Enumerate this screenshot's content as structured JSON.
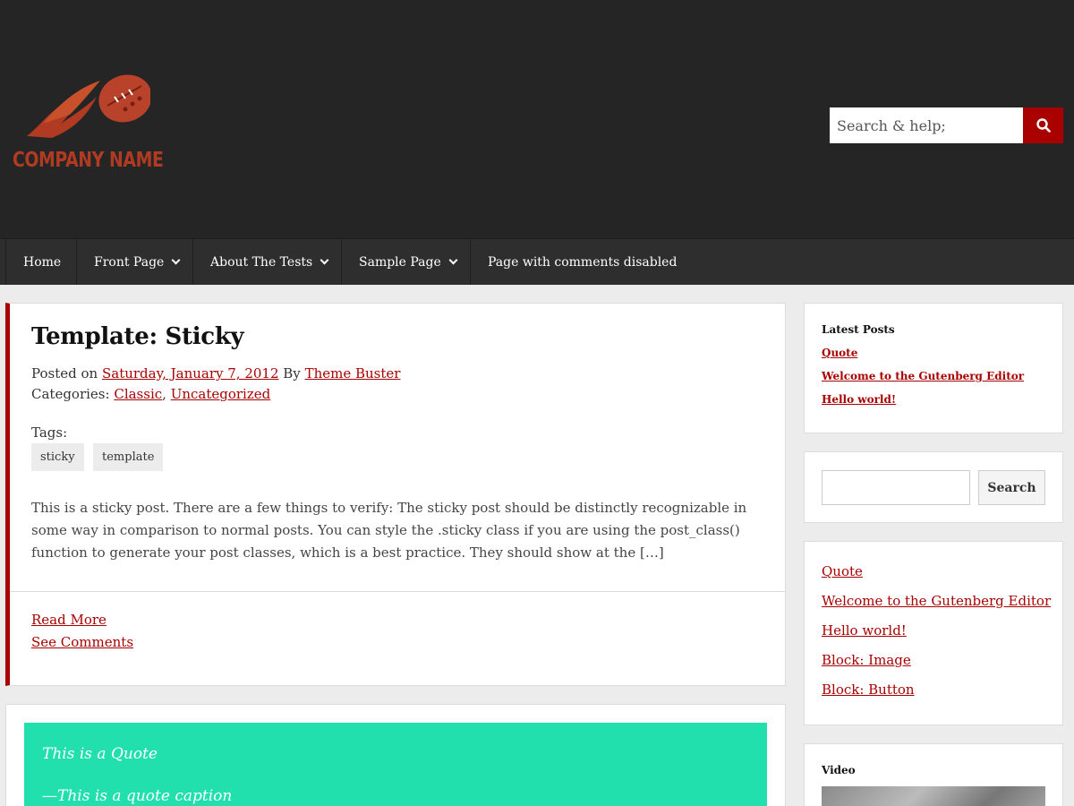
{
  "header": {
    "logo_text": "COMPANY NAME",
    "search_placeholder": "Search & help;",
    "search_icon": "search-icon"
  },
  "nav": {
    "items": [
      {
        "label": "Home"
      },
      {
        "label": "Front Page"
      },
      {
        "label": "About The Tests"
      },
      {
        "label": "Sample Page"
      },
      {
        "label": "Page with comments disabled"
      }
    ]
  },
  "post": {
    "title": "Template: Sticky",
    "posted_on_prefix": "Posted on",
    "date": "Saturday, January 7, 2012",
    "by_label": "By",
    "author": "Theme Buster",
    "categories_label": "Categories:",
    "categories": [
      "Classic",
      "Uncategorized"
    ],
    "tags_label": "Tags:",
    "tags": [
      "sticky",
      "template"
    ],
    "excerpt": "This is a sticky post. There are a few things to verify: The sticky post should be distinctly recognizable in some way in comparison to normal posts. You can style the .sticky class if you are using the post_class() function to generate your post classes, which is a best practice. They should show at the […]",
    "read_more": "Read More",
    "see_comments": "See Comments"
  },
  "quote": {
    "text": "This is a Quote",
    "caption": "—This is a quote caption"
  },
  "sidebar": {
    "latest_posts": {
      "title": "Latest Posts",
      "items": [
        "Quote",
        "Welcome to the Gutenberg Editor",
        "Hello world!"
      ]
    },
    "search": {
      "button_label": "Search"
    },
    "recent_list": {
      "items": [
        "Quote",
        "Welcome to the Gutenberg Editor",
        "Hello world!",
        "Block: Image",
        "Block: Button"
      ]
    },
    "video": {
      "title": "Video"
    }
  },
  "colors": {
    "accent": "#a90000",
    "header_bg": "#252526",
    "nav_bg": "#2e2e2e",
    "quote_bg": "#22dfae",
    "logo": "#b03a22"
  }
}
